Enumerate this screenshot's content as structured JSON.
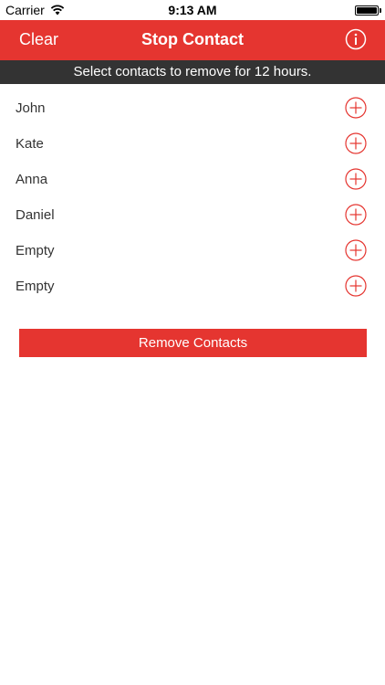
{
  "status_bar": {
    "carrier": "Carrier",
    "time": "9:13 AM",
    "icons": [
      "wifi-icon",
      "battery-icon"
    ]
  },
  "nav": {
    "left_label": "Clear",
    "title": "Stop Contact",
    "right_icon": "info-icon",
    "background_color": "#e53530"
  },
  "banner": {
    "text": "Select contacts to remove for 12 hours.",
    "background_color": "#333333"
  },
  "contacts": [
    {
      "name": "John"
    },
    {
      "name": "Kate"
    },
    {
      "name": "Anna"
    },
    {
      "name": "Daniel"
    },
    {
      "name": "Empty"
    },
    {
      "name": "Empty"
    }
  ],
  "contact_action_icon": "add-circle-icon",
  "action_button": {
    "label": "Remove Contacts",
    "background_color": "#e53530"
  }
}
